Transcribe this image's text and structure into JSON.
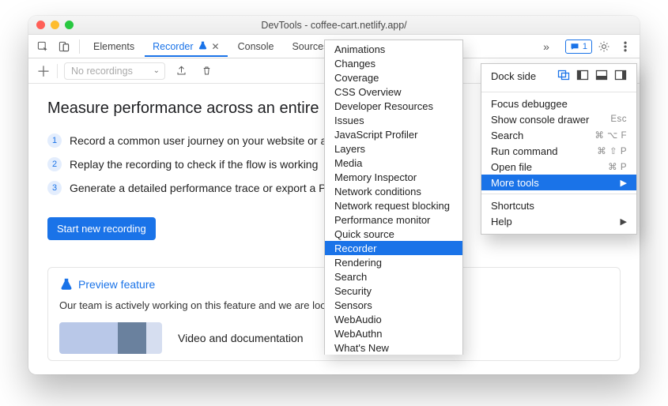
{
  "window": {
    "title": "DevTools - coffee-cart.netlify.app/"
  },
  "tabs": {
    "elements": "Elements",
    "recorder": "Recorder",
    "console": "Console",
    "sources": "Sources"
  },
  "badge_count": "1",
  "recorder_bar": {
    "dropdown_placeholder": "No recordings"
  },
  "page": {
    "heading": "Measure performance across an entire user journey",
    "step1": "Record a common user journey on your website or app",
    "step2": "Replay the recording to check if the flow is working",
    "step3": "Generate a detailed performance trace or export a Puppeteer script",
    "start_button": "Start new recording",
    "preview_title": "Preview feature",
    "preview_text": "Our team is actively working on this feature and we are looking for your feedback.",
    "video_title": "Video and documentation"
  },
  "more_tools": [
    "Animations",
    "Changes",
    "Coverage",
    "CSS Overview",
    "Developer Resources",
    "Issues",
    "JavaScript Profiler",
    "Layers",
    "Media",
    "Memory Inspector",
    "Network conditions",
    "Network request blocking",
    "Performance monitor",
    "Quick source",
    "Recorder",
    "Rendering",
    "Search",
    "Security",
    "Sensors",
    "WebAudio",
    "WebAuthn",
    "What's New"
  ],
  "more_tools_selected": "Recorder",
  "main_menu": {
    "dock_side": "Dock side",
    "focus": "Focus debuggee",
    "drawer": "Show console drawer",
    "drawer_k": "Esc",
    "search": "Search",
    "search_k": "⌘ ⌥ F",
    "run": "Run command",
    "run_k": "⌘ ⇧ P",
    "open": "Open file",
    "open_k": "⌘ P",
    "more": "More tools",
    "shortcuts": "Shortcuts",
    "help": "Help"
  }
}
